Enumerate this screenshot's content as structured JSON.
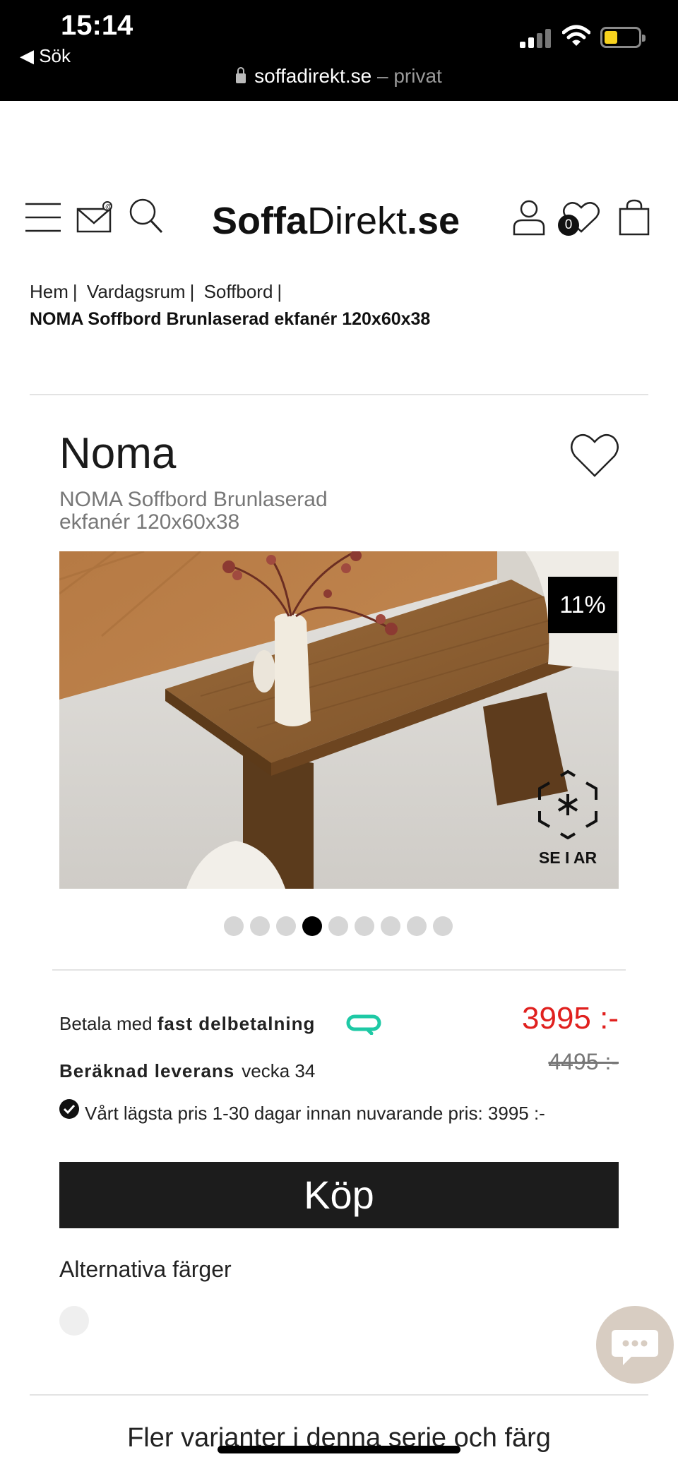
{
  "status_bar": {
    "time": "15:14",
    "back_label": "◀ Sök",
    "url": "soffadirekt.se",
    "private_label": "– privat",
    "battery_color": "#f7d21e"
  },
  "header": {
    "logo_bold": "Soffa",
    "logo_regular": "Direkt",
    "logo_suffix": ".se",
    "wishlist_count": "0",
    "icons": [
      "menu-icon",
      "mail-icon",
      "search-icon",
      "user-icon",
      "heart-icon",
      "bag-icon"
    ]
  },
  "breadcrumb": {
    "items": [
      "Hem",
      "Vardagsrum",
      "Soffbord"
    ],
    "separator": "|",
    "current": "NOMA Soffbord Brunlaserad ekfanér 120x60x38"
  },
  "product": {
    "title": "Noma",
    "subtitle": "NOMA Soffbord Brunlaserad ekfanér 120x60x38",
    "discount_badge": "11%",
    "ar_label": "SE I AR",
    "image_count": 9,
    "active_image": 4,
    "pay_prefix": "Betala med",
    "pay_bold": "fast delbetalning",
    "price": "3995 :-",
    "old_price": "4495 :-",
    "delivery_label": "Beräknad leverans",
    "delivery_value": "vecka 34",
    "lowest_price_text": "Vårt lägsta pris 1-30 dagar innan nuvarande pris: 3995 :-",
    "buy_label": "Köp",
    "alt_colors_title": "Alternativa färger",
    "price_color": "#e0201e",
    "accent_color": "#1ec9a5"
  },
  "footer": {
    "more_variants": "Fler varianter i denna serie och färg"
  }
}
